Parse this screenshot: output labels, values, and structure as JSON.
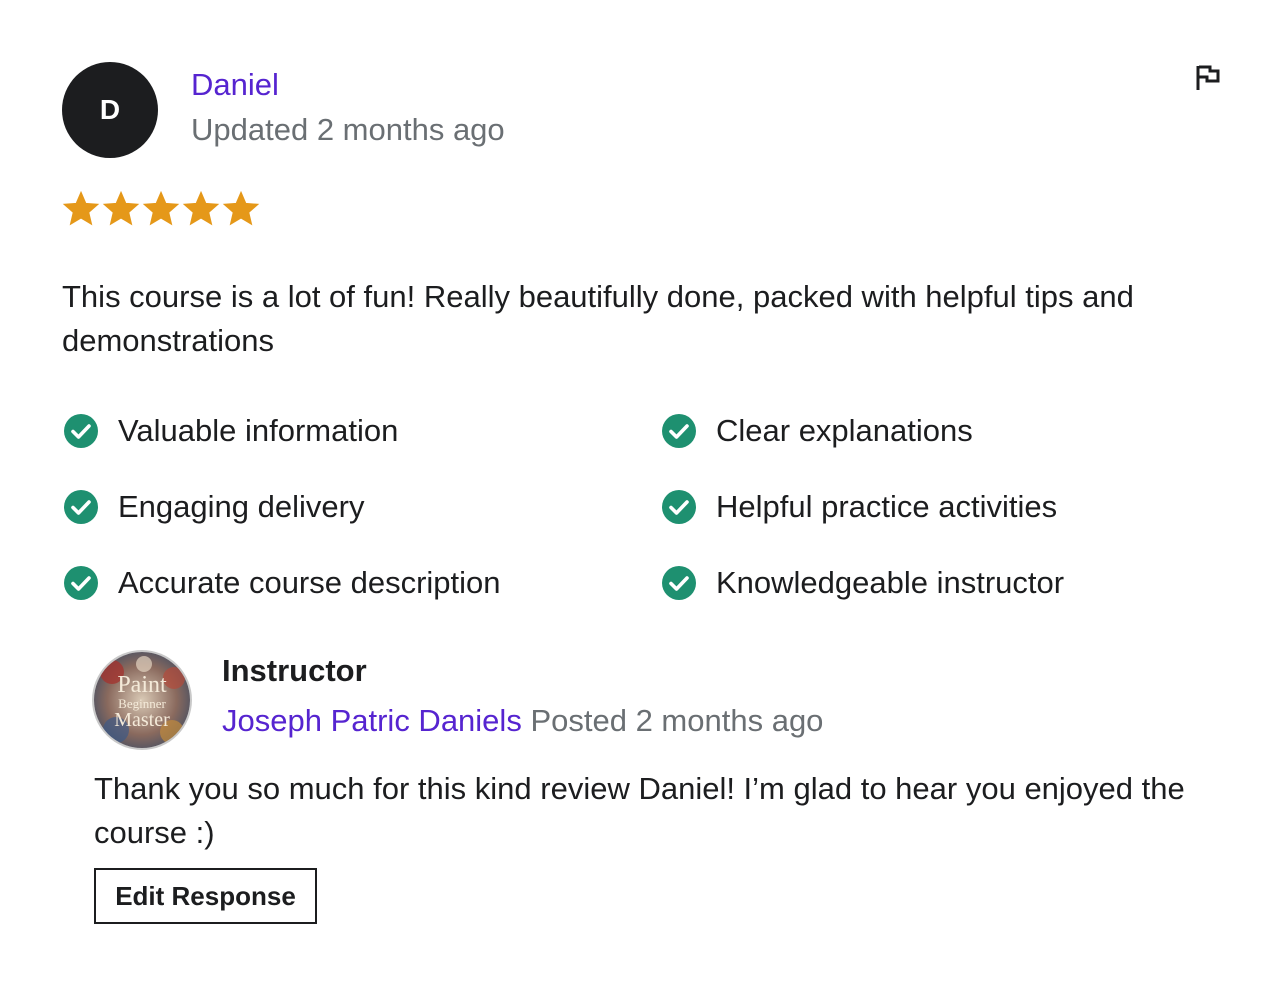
{
  "review": {
    "reviewer": {
      "initial": "D",
      "name": "Daniel",
      "updated": "Updated 2 months ago"
    },
    "rating": 5,
    "max_rating": 5,
    "star_color": "#e59819",
    "text": "This course is a lot of fun! Really beautifully done, packed with helpful tips and demonstrations",
    "flag_icon": "flag-icon",
    "tags": [
      "Valuable information",
      "Clear explanations",
      "Engaging delivery",
      "Helpful practice activities",
      "Accurate course description",
      "Knowledgeable instructor"
    ],
    "check_color": "#1e9070"
  },
  "response": {
    "title": "Instructor",
    "instructor_name": "Joseph Patric Daniels",
    "posted": "Posted 2 months ago",
    "avatar_text": [
      "Paint",
      "Beginner",
      "Master"
    ],
    "text": "Thank you so much for this kind review Daniel! I’m glad to hear you enjoyed the course :)",
    "edit_button": "Edit Response"
  },
  "colors": {
    "link": "#5624d0",
    "muted": "#6a6f73",
    "text": "#1c1d1f"
  }
}
